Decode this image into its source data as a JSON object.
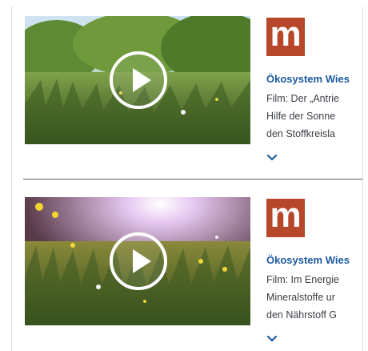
{
  "cards": [
    {
      "logo_letter": "m",
      "title": "Ökosystem Wies",
      "lines": [
        "Film: Der „Antrie",
        "Hilfe der Sonne",
        "den Stoffkreisla"
      ],
      "play_icon": "play-icon",
      "expand_icon": "chevron-down-icon"
    },
    {
      "logo_letter": "m",
      "title": "Ökosystem Wies",
      "lines": [
        "Film: Im Energie",
        "Mineralstoffe ur",
        "den Nährstoff G"
      ],
      "play_icon": "play-icon",
      "expand_icon": "chevron-down-icon"
    }
  ],
  "colors": {
    "title": "#1d5aa0",
    "logo_bg": "#b7472a",
    "chevron": "#1d5aa0",
    "divider": "#5a6470"
  }
}
